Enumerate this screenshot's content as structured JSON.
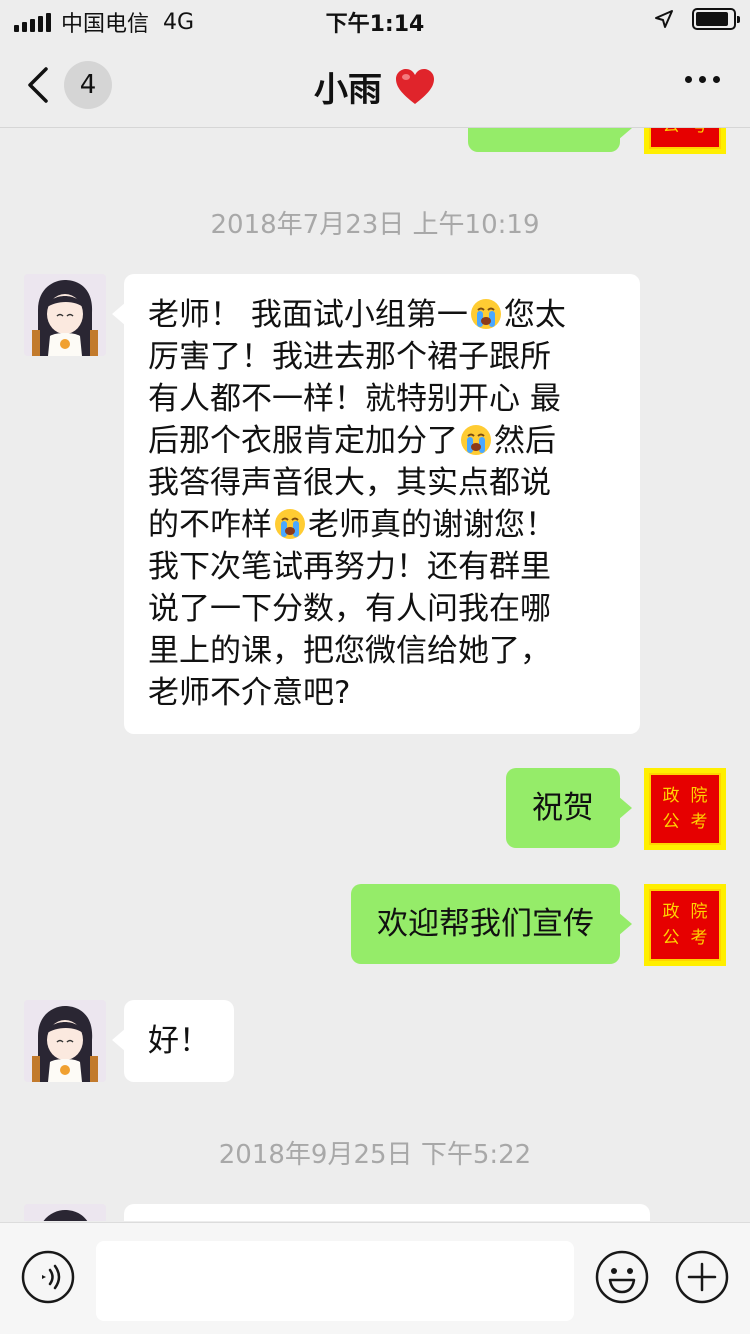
{
  "status_bar": {
    "carrier": "中国电信",
    "network": "4G",
    "time": "下午1:14"
  },
  "nav": {
    "unread_count": "4",
    "title": "小雨"
  },
  "seal_text": [
    "政",
    "院",
    "公",
    "考"
  ],
  "messages": {
    "timestamp_1": "2018年7月23日 上午10:19",
    "msg_1": {
      "line_1a": "老师！ 我面试小组第一",
      "line_1b": "您太",
      "line_2": "厉害了！我进去那个裙子跟所",
      "line_3": "有人都不一样！就特别开心 最",
      "line_4a": "后那个衣服肯定加分了",
      "line_4b": "然后",
      "line_5": "我答得声音很大，其实点都说",
      "line_6a": "的不咋样",
      "line_6b": "老师真的谢谢您！",
      "line_7": "我下次笔试再努力！还有群里",
      "line_8": "说了一下分数，有人问我在哪",
      "line_9": "里上的课，把您微信给她了，",
      "line_10": "老师不介意吧?"
    },
    "msg_2": "祝贺",
    "msg_3": "欢迎帮我们宣传",
    "msg_4": "好！",
    "timestamp_2": "2018年9月25日 下午5:22"
  },
  "input_bar": {
    "value": "",
    "placeholder": ""
  },
  "colors": {
    "background": "#ededed",
    "own_bubble": "#95ec69",
    "other_bubble": "#ffffff",
    "timestamp": "#a8a8a8"
  }
}
